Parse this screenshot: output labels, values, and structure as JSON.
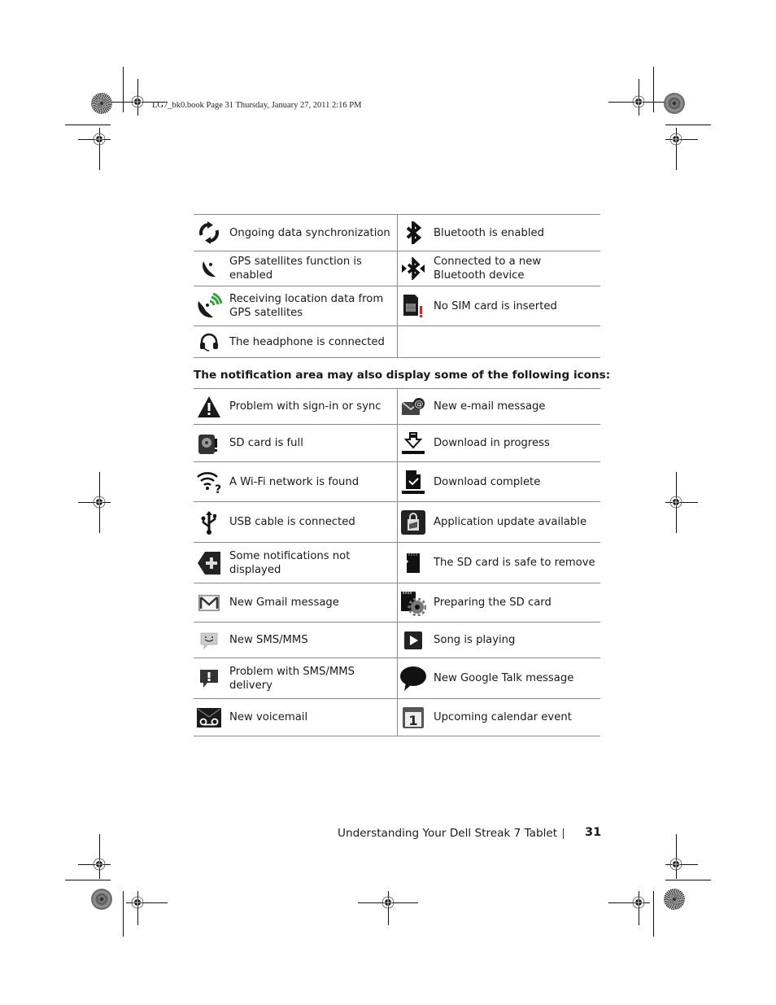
{
  "print_slug": "LG7_bk0.book  Page 31  Thursday, January 27, 2011  2:16 PM",
  "table_status": {
    "rows": [
      [
        {
          "icon": "sync-icon",
          "label": "Ongoing data synchronization"
        },
        {
          "icon": "bluetooth-icon",
          "label": "Bluetooth is enabled"
        }
      ],
      [
        {
          "icon": "gps-satellite-icon",
          "label": "GPS satellites function is enabled"
        },
        {
          "icon": "bluetooth-connected-icon",
          "label": "Connected to a new Bluetooth device"
        }
      ],
      [
        {
          "icon": "gps-receiving-icon",
          "label": "Receiving location data from GPS satellites"
        },
        {
          "icon": "no-sim-icon",
          "label": "No SIM card is inserted"
        }
      ],
      [
        {
          "icon": "headphone-icon",
          "label": "The headphone is connected"
        },
        {
          "icon": "",
          "label": ""
        }
      ]
    ]
  },
  "section_heading": "The notification area may also display some of the following icons:",
  "table_notifications": {
    "rows": [
      [
        {
          "icon": "warning-icon",
          "label": "Problem with sign-in or sync"
        },
        {
          "icon": "email-icon",
          "label": "New e-mail message"
        }
      ],
      [
        {
          "icon": "sd-card-full-icon",
          "label": "SD card is full"
        },
        {
          "icon": "download-progress-icon",
          "label": "Download in progress"
        }
      ],
      [
        {
          "icon": "wifi-found-icon",
          "label": "A Wi-Fi network is found"
        },
        {
          "icon": "download-complete-icon",
          "label": "Download complete"
        }
      ],
      [
        {
          "icon": "usb-icon",
          "label": "USB cable is connected"
        },
        {
          "icon": "app-update-icon",
          "label": "Application update available"
        }
      ],
      [
        {
          "icon": "more-notifications-icon",
          "label": "Some notifications not displayed"
        },
        {
          "icon": "sd-card-remove-icon",
          "label": "The SD card is safe to remove"
        }
      ],
      [
        {
          "icon": "gmail-icon",
          "label": "New Gmail message"
        },
        {
          "icon": "sd-card-preparing-icon",
          "label": "Preparing the SD card"
        }
      ],
      [
        {
          "icon": "sms-icon",
          "label": "New SMS/MMS"
        },
        {
          "icon": "play-icon",
          "label": "Song is playing"
        }
      ],
      [
        {
          "icon": "sms-problem-icon",
          "label": "Problem with SMS/MMS delivery"
        },
        {
          "icon": "talk-icon",
          "label": "New Google Talk message"
        }
      ],
      [
        {
          "icon": "voicemail-icon",
          "label": "New voicemail"
        },
        {
          "icon": "calendar-icon",
          "label": "Upcoming calendar event"
        }
      ]
    ]
  },
  "footer": {
    "chapter_title": "Understanding Your Dell Streak 7 Tablet",
    "page_number": "31"
  },
  "colors": {
    "gps_signal_green": "#2fa52f",
    "no_sim_alert_red": "#d9241c",
    "rule_gray": "#8a8a8a"
  }
}
